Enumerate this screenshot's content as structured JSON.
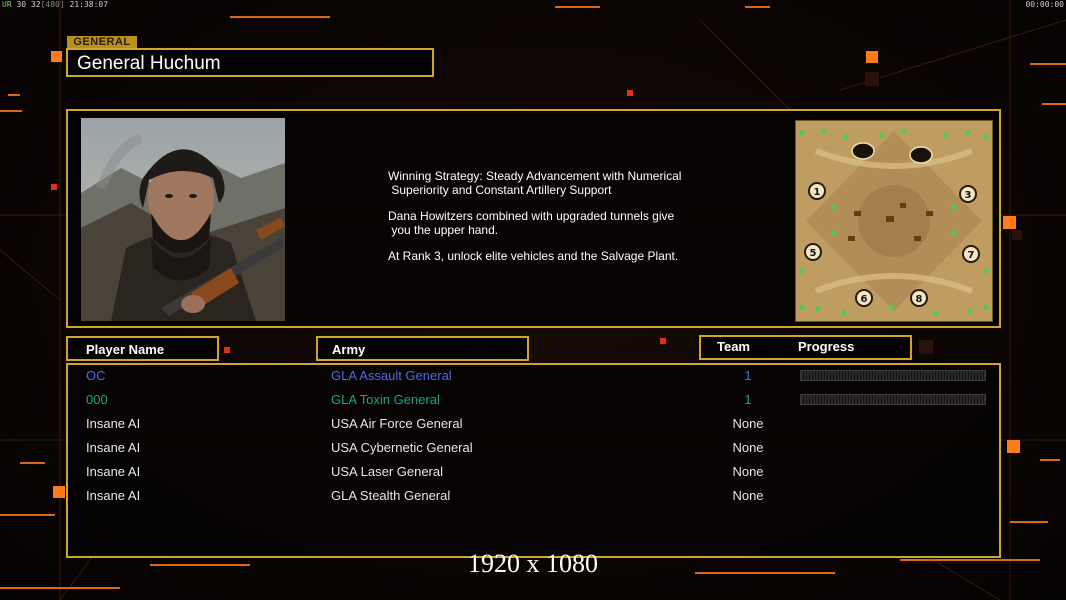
{
  "hud": {
    "ur_label": "UR",
    "stat_a": "30",
    "stat_b": "32",
    "stat_c": "[480]",
    "clock": "21:38:07",
    "timer": "00:00:00"
  },
  "general": {
    "tag": "GENERAL",
    "name": "General Huchum",
    "strategy": [
      "Winning Strategy: Steady Advancement with Numerical\n Superiority and Constant Artillery Support",
      "Dana Howitzers combined with upgraded tunnels give\n you the upper hand.",
      "At Rank 3, unlock elite vehicles and the Salvage Plant."
    ]
  },
  "minimap": {
    "start_positions": [
      "1",
      "3",
      "5",
      "7",
      "6",
      "8"
    ]
  },
  "table": {
    "headers": {
      "player": "Player Name",
      "army": "Army",
      "team": "Team",
      "progress": "Progress"
    },
    "rows": [
      {
        "player": "OC",
        "army": "GLA Assault General",
        "team": "1",
        "color": "#4a6cf0",
        "progress": true
      },
      {
        "player": "000",
        "army": "GLA Toxin General",
        "team": "1",
        "color": "#1aa58f",
        "progress": true
      },
      {
        "player": "Insane AI",
        "army": "USA Air Force General",
        "team": "None",
        "color": "#e6e6e6",
        "progress": false
      },
      {
        "player": "Insane AI",
        "army": "USA Cybernetic General",
        "team": "None",
        "color": "#e6e6e6",
        "progress": false
      },
      {
        "player": "Insane AI",
        "army": "USA Laser General",
        "team": "None",
        "color": "#e6e6e6",
        "progress": false
      },
      {
        "player": "Insane AI",
        "army": "GLA Stealth General",
        "team": "None",
        "color": "#e6e6e6",
        "progress": false
      }
    ]
  },
  "overlay": {
    "resolution": "1920 x 1080"
  },
  "colors": {
    "accent": "#d0a52a",
    "hud_orange": "#ff7a1a"
  }
}
